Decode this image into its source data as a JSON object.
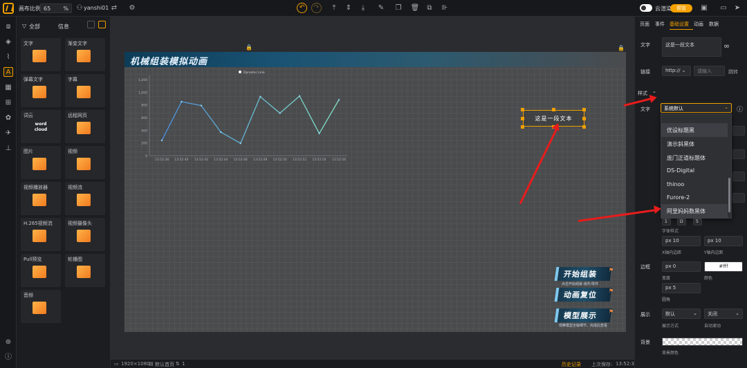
{
  "topbar": {
    "scale_label": "画布比例",
    "zoom_value": "65",
    "zoom_unit": "%",
    "user": "yanshi01",
    "cloud_render": "云渲染",
    "preview": "预览"
  },
  "panel": {
    "tab_all": "全部",
    "tab_info": "信息",
    "items": [
      {
        "label": "文字",
        "icon": "text-icon"
      },
      {
        "label": "渐变文字",
        "icon": "gradient-text-icon"
      },
      {
        "label": "弹幕文字",
        "icon": "danmaku-icon"
      },
      {
        "label": "字幕",
        "icon": "subtitle-icon"
      },
      {
        "label": "词云",
        "icon": "word-cloud-icon",
        "thumb": "word cloud"
      },
      {
        "label": "远程网页",
        "icon": "webpage-icon"
      },
      {
        "label": "图片",
        "icon": "image-icon"
      },
      {
        "label": "视频",
        "icon": "video-icon"
      },
      {
        "label": "视频播放器",
        "icon": "video-player-icon"
      },
      {
        "label": "视频流",
        "icon": "video-stream-icon"
      },
      {
        "label": "H.265视频流",
        "icon": "h265-icon"
      },
      {
        "label": "视频摄像头",
        "icon": "camera-icon"
      },
      {
        "label": "Pull预览",
        "icon": "pull-preview-icon"
      },
      {
        "label": "轮播图",
        "icon": "carousel-icon"
      },
      {
        "label": "音频",
        "icon": "audio-icon"
      }
    ]
  },
  "canvas": {
    "title": "机械组装模拟动画",
    "selected_text": "这是一段文本",
    "actions": [
      {
        "label": "开始组装",
        "sub": "点击开始组装  组件/零件"
      },
      {
        "label": "动画复位",
        "sub": ""
      },
      {
        "label": "模型展示",
        "sub": "观察模型全貌细节，完成后查看"
      }
    ]
  },
  "chart_data": {
    "type": "line",
    "legend": "Dynamic Line",
    "x": [
      "13:52:38",
      "13:52:40",
      "13:52:42",
      "13:52:44",
      "13:52:46",
      "13:52:48",
      "13:52:50",
      "13:52:52",
      "13:52:54",
      "13:52:56"
    ],
    "y_ticks": [
      "0",
      "200",
      "400",
      "600",
      "800",
      "1,000",
      "1,200"
    ],
    "values": [
      240,
      850,
      790,
      370,
      195,
      930,
      670,
      940,
      350,
      880
    ],
    "ylim": [
      0,
      1200
    ]
  },
  "status": {
    "resolution": "1920×1080",
    "page": "默认首页",
    "layers": "1",
    "history": "历史记录",
    "last_save_label": "上次保存:",
    "last_save_time": "13:52:38"
  },
  "right": {
    "tabs": [
      "页面",
      "事件",
      "基础设置",
      "动画",
      "数据"
    ],
    "active_tab": "基础设置",
    "text_label": "文字",
    "text_value": "这是一段文本",
    "link_label": "链接",
    "link_protocol": "http://",
    "link_placeholder": "请输入",
    "link_jump": "跳转",
    "style_label": "样式",
    "font_label": "文字",
    "font_value": "系统默认",
    "font_options": [
      "优设标题黑",
      "演示斜黑体",
      "庞门正道标题体",
      "DS-Digital",
      "thinoo",
      "Furore-2",
      "阿里妈妈数黑体"
    ],
    "font_style_label": "字体样式",
    "padding_x_value": "px 10",
    "padding_y_value": "px 10",
    "padding_x_label": "X轴内边距",
    "padding_y_label": "Y轴内边距",
    "border_label": "边框",
    "border_width": "px 0",
    "border_color": "#fff",
    "width_label": "宽度",
    "color_label": "颜色",
    "radius_value": "px 5",
    "radius_label": "圆角",
    "display_label": "展示",
    "display_mode": "默认",
    "auto_scroll": "关闭",
    "display_mode_label": "展示方式",
    "auto_scroll_label": "自动滚动",
    "bg_label": "背景",
    "bg_color_label": "背景颜色"
  }
}
